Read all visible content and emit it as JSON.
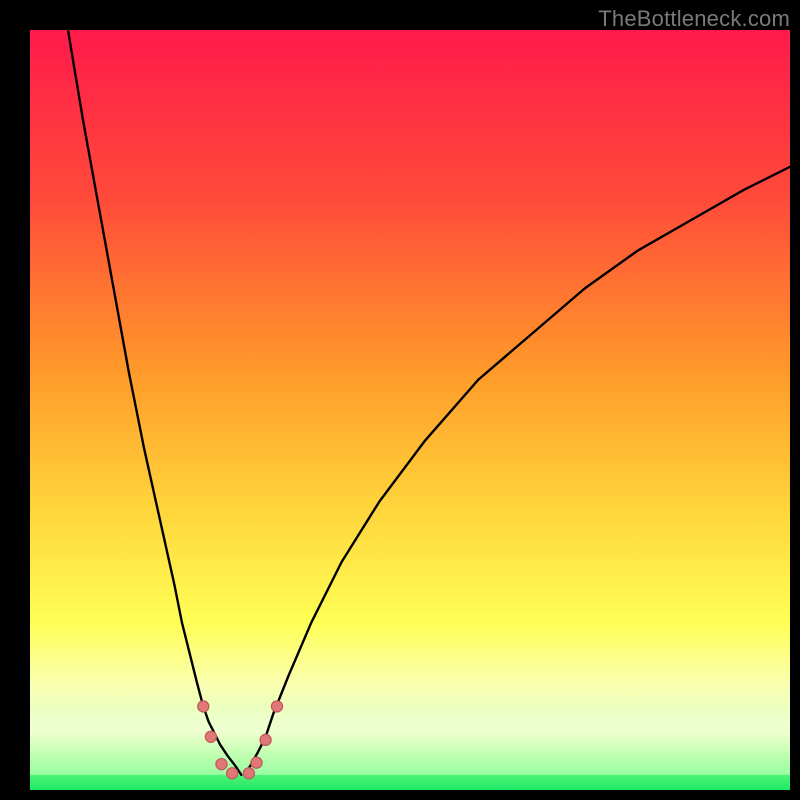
{
  "watermark": "TheBottleneck.com",
  "chart_data": {
    "type": "line",
    "title": "",
    "xlabel": "",
    "ylabel": "",
    "xlim": [
      0,
      100
    ],
    "ylim": [
      0,
      100
    ],
    "grid": false,
    "legend": false,
    "gradient_stops": [
      {
        "offset": 0.0,
        "color": "#ff1a4b"
      },
      {
        "offset": 0.22,
        "color": "#ff4a3a"
      },
      {
        "offset": 0.45,
        "color": "#ff9a2a"
      },
      {
        "offset": 0.62,
        "color": "#ffd23a"
      },
      {
        "offset": 0.78,
        "color": "#ffff55"
      },
      {
        "offset": 0.86,
        "color": "#faffb0"
      },
      {
        "offset": 0.92,
        "color": "#e0ffcc"
      },
      {
        "offset": 0.96,
        "color": "#7fff7f"
      },
      {
        "offset": 1.0,
        "color": "#1fe868"
      }
    ],
    "series": [
      {
        "name": "left-curve",
        "color": "#000000",
        "x": [
          5,
          7,
          9,
          11,
          13,
          15,
          17,
          19,
          20,
          21,
          22,
          22.8,
          23.5,
          24,
          25,
          26,
          27,
          27.8
        ],
        "y": [
          100,
          88,
          77,
          66,
          55,
          45,
          36,
          27,
          22,
          18,
          14,
          11,
          9,
          8,
          6,
          4.5,
          3.2,
          2
        ]
      },
      {
        "name": "right-curve",
        "color": "#000000",
        "x": [
          28.2,
          29,
          30,
          31,
          32,
          34,
          37,
          41,
          46,
          52,
          59,
          66,
          73,
          80,
          87,
          94,
          100
        ],
        "y": [
          2,
          3.2,
          5,
          7,
          10,
          15,
          22,
          30,
          38,
          46,
          54,
          60,
          66,
          71,
          75,
          79,
          82
        ]
      }
    ],
    "buffer_band": {
      "y_top": 11,
      "y_bottom": 2,
      "color_top": "#ffffd5",
      "color_bottom": "#b8ffb8"
    },
    "markers": [
      {
        "x": 22.8,
        "y": 11.0
      },
      {
        "x": 23.8,
        "y": 7.0
      },
      {
        "x": 25.2,
        "y": 3.4
      },
      {
        "x": 26.6,
        "y": 2.2
      },
      {
        "x": 28.8,
        "y": 2.2
      },
      {
        "x": 29.8,
        "y": 3.6
      },
      {
        "x": 31.0,
        "y": 6.6
      },
      {
        "x": 32.5,
        "y": 11.0
      }
    ],
    "marker_style": {
      "r": 5.6,
      "fill": "#e07878",
      "stroke": "#c05858"
    }
  }
}
